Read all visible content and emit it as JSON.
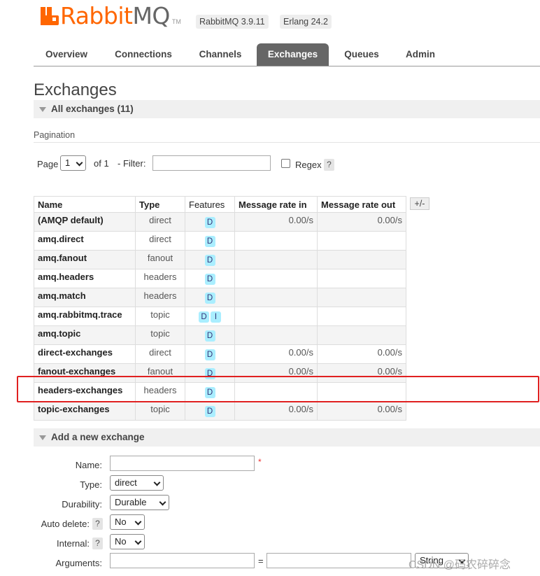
{
  "header": {
    "logo_rabbit": "Rabbit",
    "logo_mq": "MQ",
    "logo_tm": "TM",
    "rabbitmq_version": "RabbitMQ 3.9.11",
    "erlang_version": "Erlang 24.2"
  },
  "nav": {
    "tabs": [
      {
        "label": "Overview",
        "active": false
      },
      {
        "label": "Connections",
        "active": false
      },
      {
        "label": "Channels",
        "active": false
      },
      {
        "label": "Exchanges",
        "active": true
      },
      {
        "label": "Queues",
        "active": false
      },
      {
        "label": "Admin",
        "active": false
      }
    ]
  },
  "page": {
    "title": "Exchanges",
    "all_exchanges_header": "All exchanges (11)"
  },
  "pagination": {
    "label": "Pagination",
    "page_label": "Page",
    "page_value": "1",
    "of_label": "of 1",
    "filter_label": "- Filter:",
    "filter_value": "",
    "regex_label": "Regex",
    "help": "?"
  },
  "table": {
    "columns": [
      "Name",
      "Type",
      "Features",
      "Message rate in",
      "Message rate out"
    ],
    "plus_minus": "+/-",
    "rows": [
      {
        "name": "(AMQP default)",
        "type": "direct",
        "features": [
          "D"
        ],
        "rate_in": "0.00/s",
        "rate_out": "0.00/s"
      },
      {
        "name": "amq.direct",
        "type": "direct",
        "features": [
          "D"
        ],
        "rate_in": "",
        "rate_out": ""
      },
      {
        "name": "amq.fanout",
        "type": "fanout",
        "features": [
          "D"
        ],
        "rate_in": "",
        "rate_out": ""
      },
      {
        "name": "amq.headers",
        "type": "headers",
        "features": [
          "D"
        ],
        "rate_in": "",
        "rate_out": ""
      },
      {
        "name": "amq.match",
        "type": "headers",
        "features": [
          "D"
        ],
        "rate_in": "",
        "rate_out": ""
      },
      {
        "name": "amq.rabbitmq.trace",
        "type": "topic",
        "features": [
          "D",
          "I"
        ],
        "rate_in": "",
        "rate_out": ""
      },
      {
        "name": "amq.topic",
        "type": "topic",
        "features": [
          "D"
        ],
        "rate_in": "",
        "rate_out": ""
      },
      {
        "name": "direct-exchanges",
        "type": "direct",
        "features": [
          "D"
        ],
        "rate_in": "0.00/s",
        "rate_out": "0.00/s"
      },
      {
        "name": "fanout-exchanges",
        "type": "fanout",
        "features": [
          "D"
        ],
        "rate_in": "0.00/s",
        "rate_out": "0.00/s"
      },
      {
        "name": "headers-exchanges",
        "type": "headers",
        "features": [
          "D"
        ],
        "rate_in": "",
        "rate_out": ""
      },
      {
        "name": "topic-exchanges",
        "type": "topic",
        "features": [
          "D"
        ],
        "rate_in": "0.00/s",
        "rate_out": "0.00/s"
      }
    ],
    "highlight_color": "#e02020"
  },
  "add_exchange": {
    "header": "Add a new exchange",
    "name_label": "Name:",
    "name_value": "",
    "required_mark": "*",
    "type_label": "Type:",
    "type_value": "direct",
    "durability_label": "Durability:",
    "durability_value": "Durable",
    "auto_delete_label": "Auto delete:",
    "auto_delete_value": "No",
    "internal_label": "Internal:",
    "internal_value": "No",
    "arguments_label": "Arguments:",
    "arguments_eq": "=",
    "arguments_type": "String",
    "help": "?"
  },
  "watermark": "CSDN @码农碎碎念",
  "colors": {
    "brand_orange": "#ff6600",
    "active_tab": "#666666",
    "feature_badge": "#aaeeff"
  }
}
